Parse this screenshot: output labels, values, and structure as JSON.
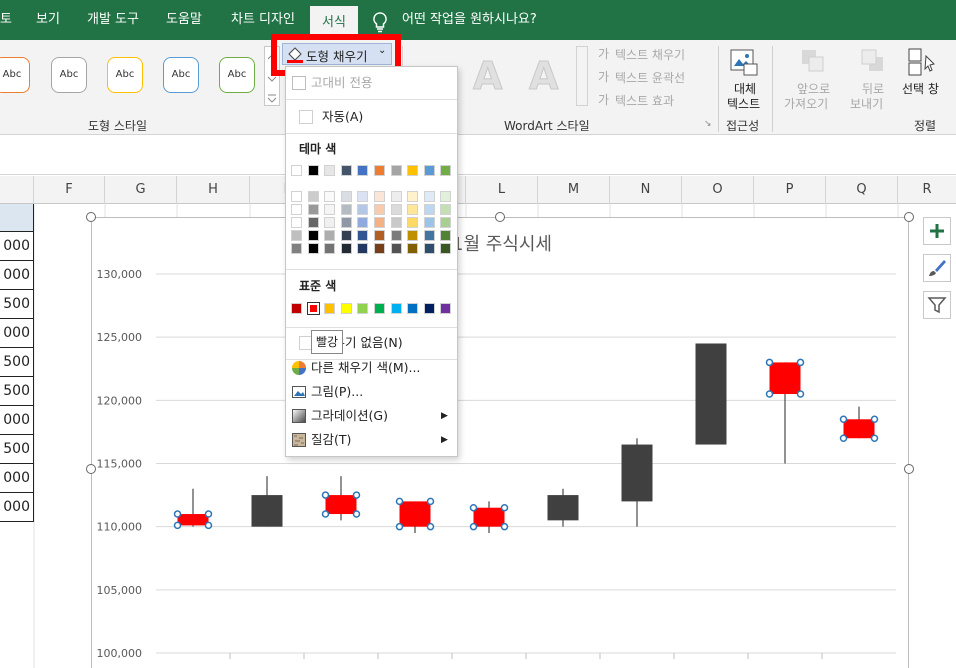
{
  "tabs": {
    "home_partial": "토",
    "view": "보기",
    "developer": "개발 도구",
    "help": "도움말",
    "chart_design": "차트 디자인",
    "format": "서식",
    "tell_me": "어떤 작업을 원하시나요?"
  },
  "ribbon": {
    "shape_styles": [
      "Abc",
      "Abc",
      "Abc",
      "Abc",
      "Abc"
    ],
    "shape_style_colors": [
      "#ed7d31",
      "#a5a5a5",
      "#ffc000",
      "#5b9bd5",
      "#70ad47"
    ],
    "shape_styles_group": "도형 스타일",
    "shape_fill_button": "도형 채우기",
    "wordart_letters": [
      "A",
      "A"
    ],
    "text_fill": "텍스트 채우기",
    "text_outline": "텍스트 윤곽선",
    "text_effects": "텍스트 효과",
    "wordart_group": "WordArt 스타일",
    "alt_text_line1": "대체",
    "alt_text_line2": "텍스트",
    "accessibility_group": "접근성",
    "bring_forward_line1": "앞으로",
    "bring_forward_line2": "가져오기",
    "send_backward_line1": "뒤로",
    "send_backward_line2": "보내기",
    "selection_pane": "선택 창",
    "arrange_group": "정렬"
  },
  "columns": [
    "F",
    "G",
    "H",
    "I",
    "J",
    "K",
    "L",
    "M",
    "N",
    "O",
    "P",
    "Q",
    "R"
  ],
  "left_cells": [
    "000",
    "000",
    "500",
    "000",
    "500",
    "500",
    "000",
    "500",
    "000",
    "000"
  ],
  "dropdown": {
    "high_contrast_only": "고대비 전용",
    "automatic": "자동(A)",
    "theme_colors_title": "테마 색",
    "standard_colors_title": "표준 색",
    "no_fill": "채우기 없음(N)",
    "more_fill_colors": "다른 채우기 색(M)...",
    "picture": "그림(P)...",
    "gradient": "그라데이션(G)",
    "texture": "질감(T)",
    "theme_row": [
      "#ffffff",
      "#000000",
      "#e7e6e6",
      "#44546a",
      "#4472c4",
      "#ed7d31",
      "#a5a5a5",
      "#ffc000",
      "#5b9bd5",
      "#70ad47"
    ],
    "standard_colors": [
      "#c00000",
      "#ff0000",
      "#ffc000",
      "#ffff00",
      "#92d050",
      "#00b050",
      "#00b0f0",
      "#0070c0",
      "#002060",
      "#7030a0"
    ]
  },
  "tooltip": "빨강",
  "chart_data": {
    "type": "candlestick",
    "title_partial": "1월 주식시세",
    "ylim": [
      100000,
      130000
    ],
    "yticks": [
      "130,000",
      "125,000",
      "120,000",
      "115,000",
      "110,000",
      "105,000",
      "100,000"
    ],
    "candles": [
      {
        "open": 111000,
        "close": 110100,
        "high": 113000,
        "low": 110000,
        "color": "#ff0000"
      },
      {
        "open": 110000,
        "close": 112500,
        "high": 114000,
        "low": 110000,
        "color": "#404040"
      },
      {
        "open": 112500,
        "close": 111000,
        "high": 114000,
        "low": 110500,
        "color": "#ff0000"
      },
      {
        "open": 112000,
        "close": 110000,
        "high": 112000,
        "low": 109500,
        "color": "#ff0000"
      },
      {
        "open": 111500,
        "close": 110000,
        "high": 112000,
        "low": 109500,
        "color": "#ff0000"
      },
      {
        "open": 110500,
        "close": 112500,
        "high": 113000,
        "low": 110000,
        "color": "#404040"
      },
      {
        "open": 112000,
        "close": 116500,
        "high": 117000,
        "low": 110000,
        "color": "#404040"
      },
      {
        "open": 116500,
        "close": 124500,
        "high": 124500,
        "low": 116500,
        "color": "#404040"
      },
      {
        "open": 123000,
        "close": 120500,
        "high": 123000,
        "low": 115000,
        "color": "#ff0000"
      },
      {
        "open": 118500,
        "close": 117000,
        "high": 119500,
        "low": 117000,
        "color": "#ff0000"
      }
    ]
  }
}
